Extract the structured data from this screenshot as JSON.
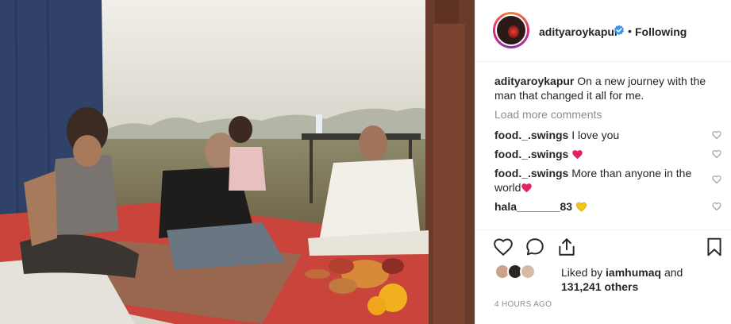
{
  "post": {
    "username": "adityaroykapur",
    "follow_state": "Following",
    "separator": "•"
  },
  "caption": {
    "username": "adityaroykapur",
    "text": " On a new journey with the man that changed it all for me."
  },
  "load_more": "Load more comments",
  "comments": [
    {
      "username": "food._.swings",
      "text": " I love you",
      "emoji": ""
    },
    {
      "username": "food._.swings",
      "text": " ",
      "emoji": "red-heart"
    },
    {
      "username": "food._.swings",
      "text": " More than anyone in the world",
      "emoji": "red-heart"
    },
    {
      "username": "hala_______83",
      "text": " ",
      "emoji": "yellow-heart"
    }
  ],
  "likes": {
    "prefix": "Liked by ",
    "liker": "iamhumaq",
    "joiner": " and",
    "count": "131,241 others"
  },
  "timestamp": "4 HOURS AGO",
  "icons": {
    "like": "heart-outline-icon",
    "comment": "comment-bubble-icon",
    "share": "share-icon",
    "save": "bookmark-icon",
    "verified": "verified-badge-icon"
  },
  "colors": {
    "verified": "#3897f0",
    "heart_red": "#ed4956",
    "heart_yellow": "#f5c518",
    "muted": "#8e8e8e",
    "text": "#262626"
  }
}
